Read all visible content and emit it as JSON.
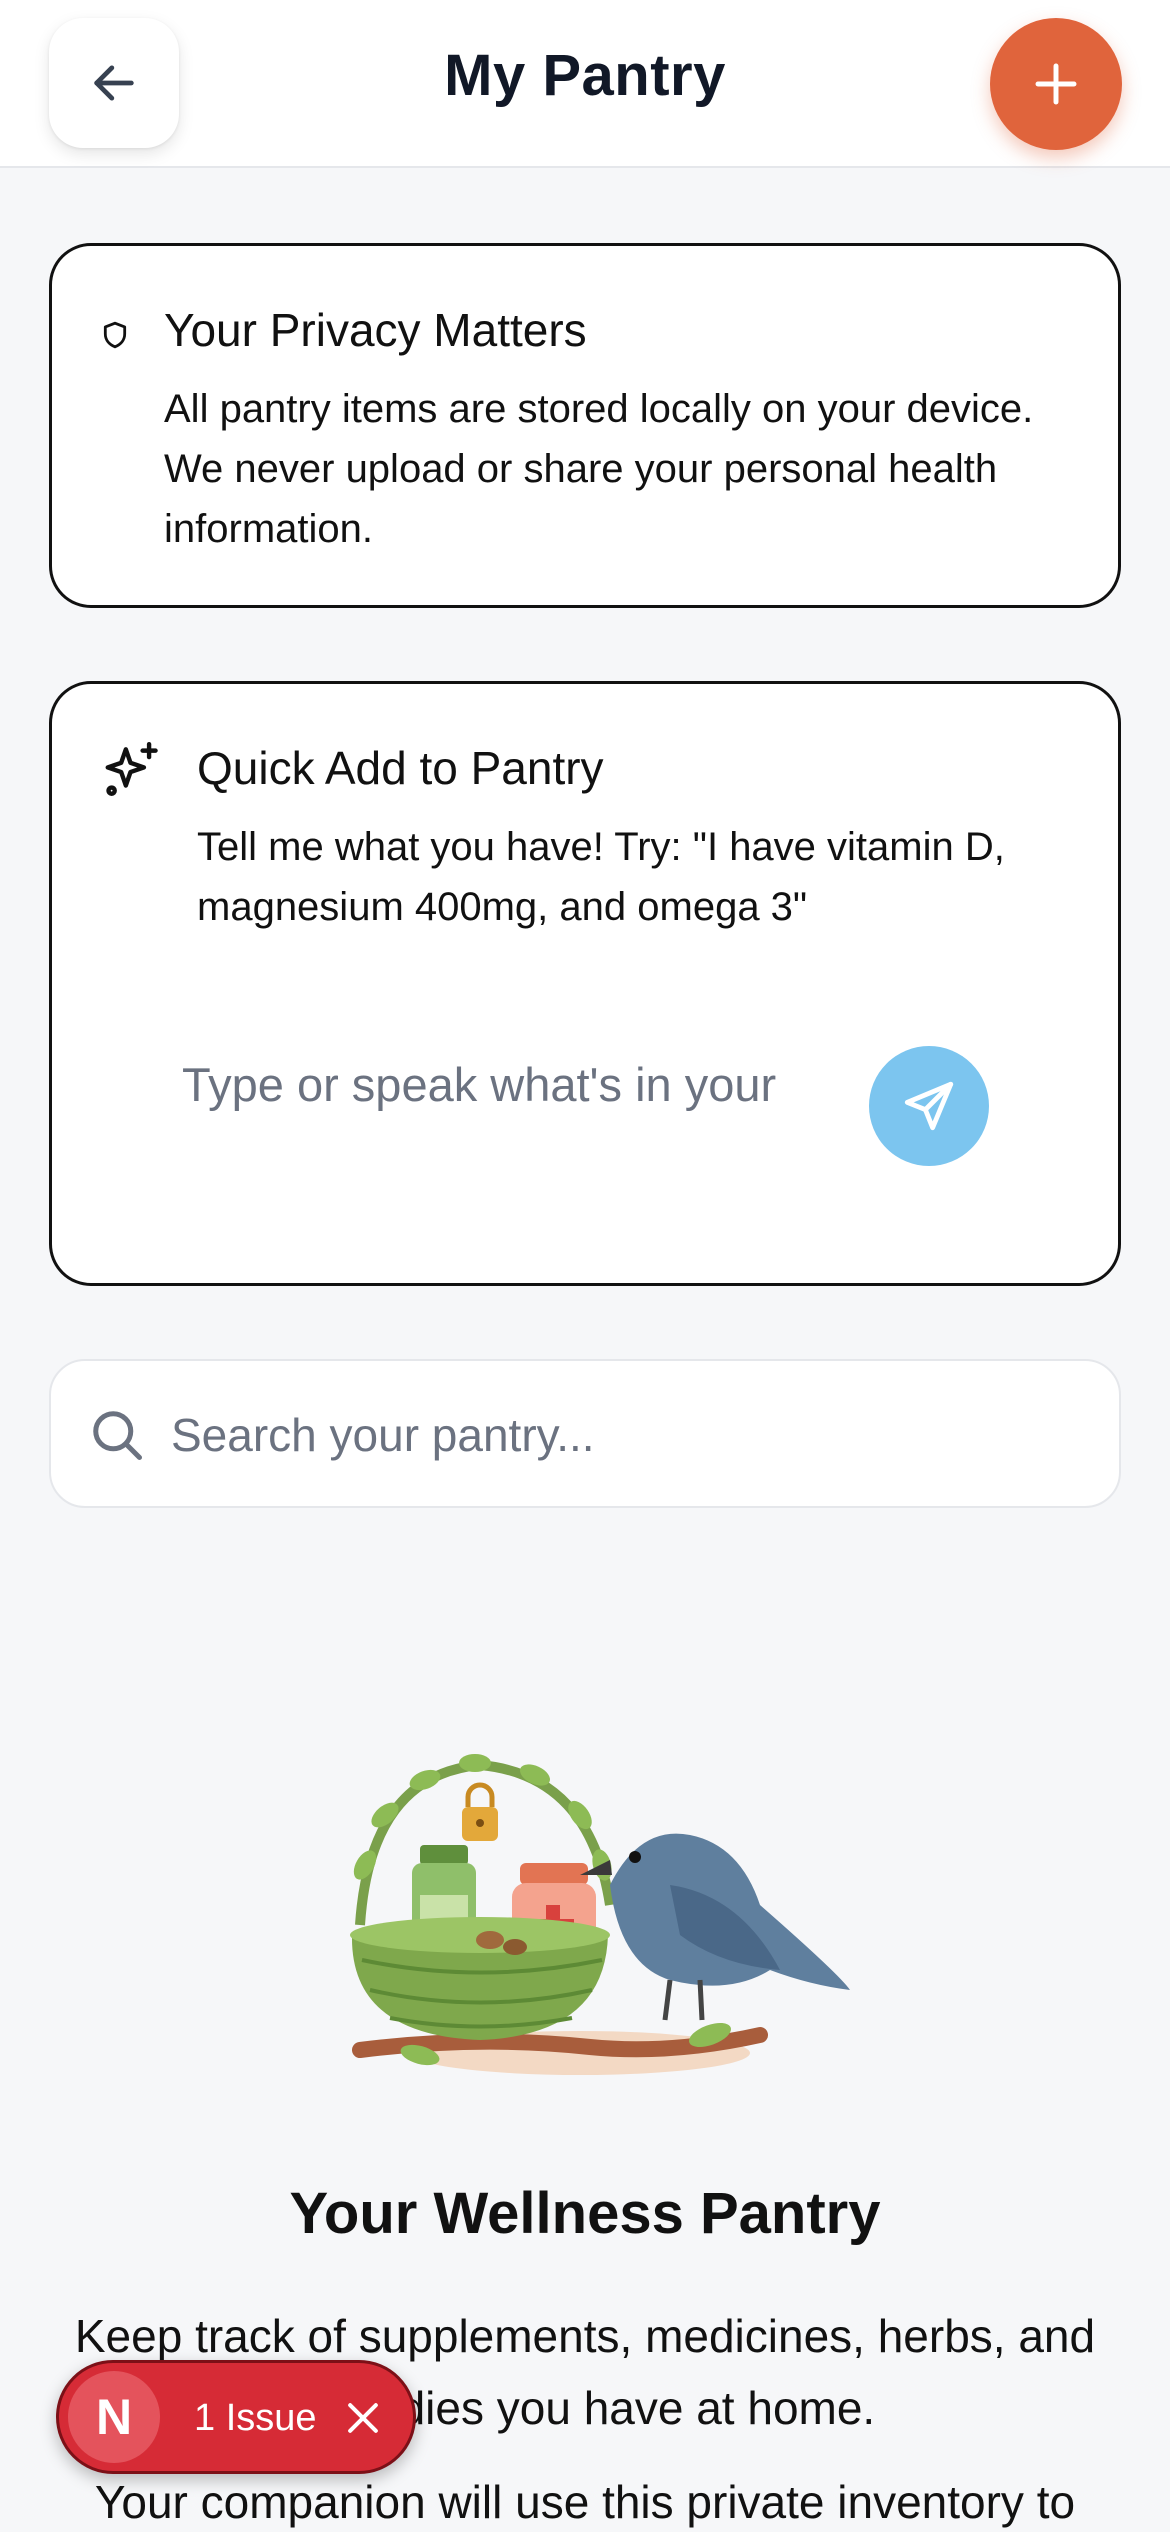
{
  "header": {
    "title": "My Pantry",
    "back_icon": "arrow-left-icon",
    "add_icon": "plus-icon",
    "accent_color": "#e0643c"
  },
  "privacy": {
    "icon": "shield-icon",
    "title": "Your Privacy Matters",
    "text": "All pantry items are stored locally on your device. We never upload or share your personal health information."
  },
  "quick_add": {
    "icon": "sparkles-icon",
    "title": "Quick Add to Pantry",
    "hint": "Tell me what you have! Try: \"I have vitamin D, magnesium 400mg, and omega 3\"",
    "input_placeholder": "Type or speak what's in your",
    "input_value": "",
    "send_icon": "send-icon",
    "send_color": "#7cc5ef"
  },
  "search": {
    "icon": "search-icon",
    "placeholder": "Search your pantry...",
    "value": ""
  },
  "empty_state": {
    "illustration": "bird-with-herbal-basket-illustration",
    "title": "Your Wellness Pantry",
    "text": "Keep track of supplements, medicines, herbs, and remedies you have at home.",
    "text2": "Your companion will use this private inventory to"
  },
  "issue_badge": {
    "logo": "N",
    "label": "1 Issue",
    "close_icon": "close-icon",
    "color": "#d62b36"
  }
}
